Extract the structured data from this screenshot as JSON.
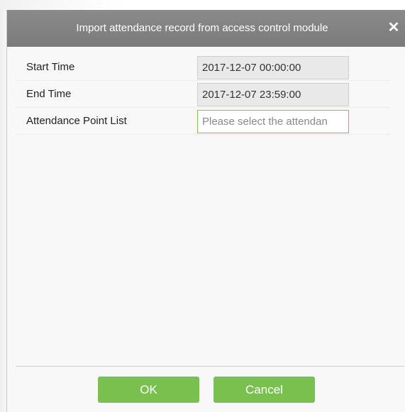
{
  "dialog": {
    "title": "Import attendance record from access control module",
    "close_icon": "close-icon",
    "close_glyph": "✕"
  },
  "form": {
    "start_time": {
      "label": "Start Time",
      "value": "2017-12-07 00:00:00"
    },
    "end_time": {
      "label": "End Time",
      "value": "2017-12-07 23:59:00"
    },
    "attendance_point_list": {
      "label": "Attendance Point List",
      "placeholder": "Please select the attendan"
    }
  },
  "buttons": {
    "ok_label": "OK",
    "cancel_label": "Cancel"
  },
  "colors": {
    "titlebar": "#808080",
    "button": "#79c04f",
    "select_border": "#7cc35a",
    "readonly_field": "#e9e9e9"
  }
}
